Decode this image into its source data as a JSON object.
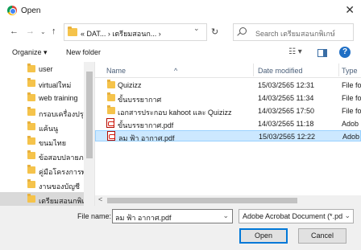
{
  "window": {
    "title": "Open",
    "close_icon": "close-icon"
  },
  "nav": {
    "back": "←",
    "forward": "→",
    "recent": "⌄",
    "up": "↑",
    "address": "« DAT... › เตรียมสอนก... ›",
    "address_drop": "⌄",
    "refresh": "↻",
    "search_placeholder": "Search เตรียมสอนกพิเกษ์"
  },
  "toolbar": {
    "organize": "Organize ▾",
    "new_folder": "New folder",
    "view": "☷ ▾",
    "help": "?"
  },
  "sidebar": {
    "items": [
      {
        "label": "user"
      },
      {
        "label": "virtualใหม่"
      },
      {
        "label": "web training"
      },
      {
        "label": "กรอบเครื่องปรุง"
      },
      {
        "label": "แค้นนู"
      },
      {
        "label": "ขนมไทย"
      },
      {
        "label": "ข้อสอบปลายภาค"
      },
      {
        "label": "คู่มือโครงการพพพ"
      },
      {
        "label": "งานของบัญชี"
      },
      {
        "label": "เตรียมสอนกพิเกษ์"
      }
    ]
  },
  "columns": {
    "name": "Name",
    "date": "Date modified",
    "type": "Type",
    "sort_caret": "^"
  },
  "files": [
    {
      "icon": "folder-icon",
      "name": "Quizizz",
      "date": "15/03/2565 12:31",
      "type": "File fo"
    },
    {
      "icon": "folder-icon",
      "name": "ขั้นบรรยากาศ",
      "date": "14/03/2565 11:34",
      "type": "File fo"
    },
    {
      "icon": "folder-icon",
      "name": "เอกสารประกอบ kahoot และ Quizizz",
      "date": "14/03/2565 17:50",
      "type": "File fo"
    },
    {
      "icon": "pdf-icon",
      "name": "ขั้นบรรยากาศ.pdf",
      "date": "14/03/2565 11:18",
      "type": "Adob"
    },
    {
      "icon": "pdf-icon",
      "name": "ลม ฟ้า อากาศ.pdf",
      "date": "15/03/2565 12:22",
      "type": "Adob"
    }
  ],
  "scroll": {
    "left_arrow": "<"
  },
  "footer": {
    "file_name_label": "File name:",
    "file_name_value": "ลม ฟ้า อากาศ.pdf",
    "file_name_drop": "⌄",
    "file_type_value": "Adobe Acrobat Document (*.pdf)",
    "file_type_drop": "⌄",
    "open": "Open",
    "cancel": "Cancel"
  }
}
